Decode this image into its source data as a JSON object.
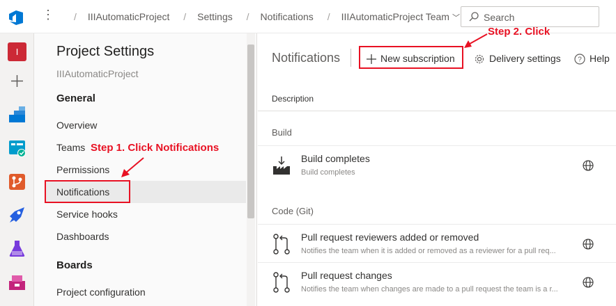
{
  "header": {
    "breadcrumbs": [
      "IIIAutomaticProject",
      "Settings",
      "Notifications",
      "IIIAutomaticProject Team"
    ],
    "search_placeholder": "Search"
  },
  "leftnav": {
    "icons": [
      "project-avatar",
      "add",
      "overview",
      "boards",
      "repos",
      "pipelines",
      "test-plans",
      "artifacts"
    ],
    "avatar_letter": "I",
    "colors": {
      "avatar": "#cc2936",
      "boards": "#009ccc",
      "repos": "#e05b2b",
      "pipelines": "#2560e0",
      "test": "#773adc",
      "artifacts": "#c3247c"
    }
  },
  "settings": {
    "title": "Project Settings",
    "project": "IIIAutomaticProject",
    "general_heading": "General",
    "items": [
      "Overview",
      "Teams",
      "Permissions",
      "Notifications",
      "Service hooks",
      "Dashboards"
    ],
    "boards_heading": "Boards",
    "boards_items": [
      "Project configuration"
    ]
  },
  "annotations": {
    "step1": "Step 1. Click Notifications",
    "step2": "Step 2. Click",
    "color": "#e81123"
  },
  "main": {
    "title": "Notifications",
    "toolbar": {
      "new_subscription": "New subscription",
      "delivery_settings": "Delivery settings",
      "help": "Help"
    },
    "column_header": "Description",
    "groups": [
      {
        "name": "Build",
        "rows": [
          {
            "title": "Build completes",
            "subtitle": "Build completes"
          }
        ]
      },
      {
        "name": "Code (Git)",
        "rows": [
          {
            "title": "Pull request reviewers added or removed",
            "subtitle": "Notifies the team when it is added or removed as a reviewer for a pull req..."
          },
          {
            "title": "Pull request changes",
            "subtitle": "Notifies the team when changes are made to a pull request the team is a r..."
          }
        ]
      }
    ]
  }
}
